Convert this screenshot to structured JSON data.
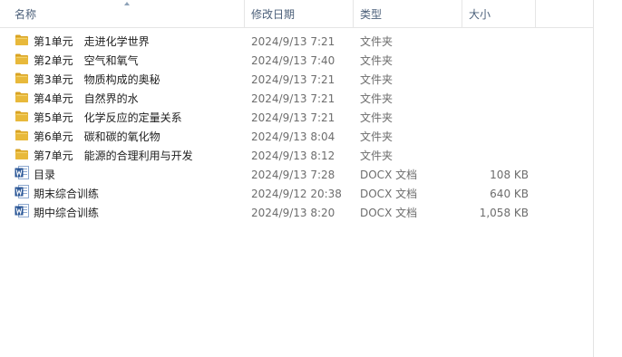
{
  "columns": {
    "name": "名称",
    "date": "修改日期",
    "type": "类型",
    "size": "大小"
  },
  "files": [
    {
      "icon": "folder-icon",
      "name": "第1单元　走进化学世界",
      "date": "2024/9/13 7:21",
      "type": "文件夹",
      "size": ""
    },
    {
      "icon": "folder-icon",
      "name": "第2单元　空气和氧气",
      "date": "2024/9/13 7:40",
      "type": "文件夹",
      "size": ""
    },
    {
      "icon": "folder-icon",
      "name": "第3单元　物质构成的奥秘",
      "date": "2024/9/13 7:21",
      "type": "文件夹",
      "size": ""
    },
    {
      "icon": "folder-icon",
      "name": "第4单元　自然界的水",
      "date": "2024/9/13 7:21",
      "type": "文件夹",
      "size": ""
    },
    {
      "icon": "folder-icon",
      "name": "第5单元　化学反应的定量关系",
      "date": "2024/9/13 7:21",
      "type": "文件夹",
      "size": ""
    },
    {
      "icon": "folder-icon",
      "name": "第6单元　碳和碳的氧化物",
      "date": "2024/9/13 8:04",
      "type": "文件夹",
      "size": ""
    },
    {
      "icon": "folder-icon",
      "name": "第7单元　能源的合理利用与开发",
      "date": "2024/9/13 8:12",
      "type": "文件夹",
      "size": ""
    },
    {
      "icon": "word-doc-icon",
      "name": "目录",
      "date": "2024/9/13 7:28",
      "type": "DOCX 文档",
      "size": "108 KB"
    },
    {
      "icon": "word-doc-icon",
      "name": "期末综合训练",
      "date": "2024/9/12 20:38",
      "type": "DOCX 文档",
      "size": "640 KB"
    },
    {
      "icon": "word-doc-icon",
      "name": "期中综合训练",
      "date": "2024/9/13 8:20",
      "type": "DOCX 文档",
      "size": "1,058 KB"
    }
  ],
  "colors": {
    "folder": "#e8b93b",
    "word": "#2b5797",
    "header_text": "#4c607a"
  }
}
